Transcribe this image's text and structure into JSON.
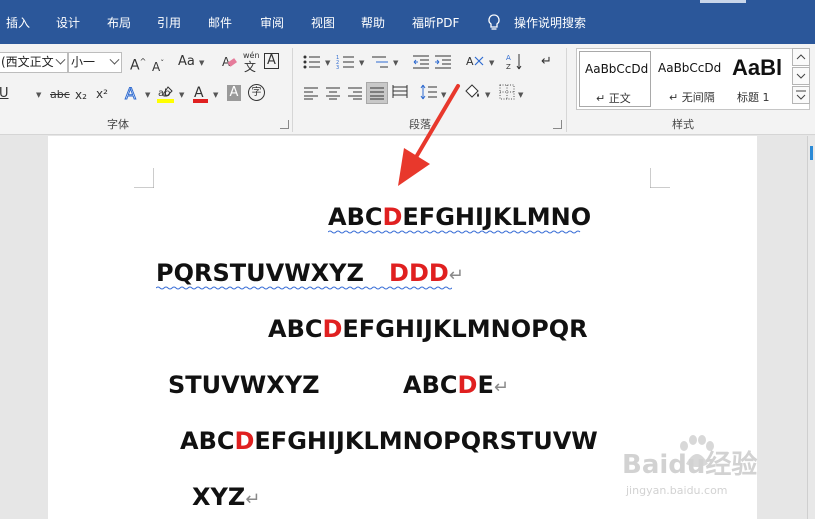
{
  "tabs": [
    "插入",
    "设计",
    "布局",
    "引用",
    "邮件",
    "审阅",
    "视图",
    "帮助",
    "福昕PDF"
  ],
  "tell_me": "操作说明搜索",
  "font_group": {
    "font_name": "(西文正文",
    "font_size": "小一",
    "label": "字体",
    "change_case": "Aa",
    "phonetic_top": "wén",
    "phonetic_bottom": "文",
    "char_border": "A",
    "enclose_char": "字",
    "underline": "U",
    "strike": "abc",
    "subscript": "x₂",
    "superscript": "x²"
  },
  "paragraph_group": {
    "label": "段落"
  },
  "styles_group": {
    "label": "样式",
    "items": [
      {
        "sample": "AaBbCcDd",
        "name": "↵ 正文"
      },
      {
        "sample": "AaBbCcDd",
        "name": "↵ 无间隔"
      },
      {
        "sample": "AaBl",
        "name": "标题 1"
      }
    ]
  },
  "document": {
    "lines": [
      {
        "parts": [
          "ABC",
          "D",
          "EFGHIJKLMNO"
        ],
        "mark": ""
      },
      {
        "parts": [
          "PQRSTUVWXYZ   ",
          "DDD",
          ""
        ],
        "mark": "↵"
      },
      {
        "parts": [
          "ABC",
          "D",
          "EFGHIJKLMNOPQR"
        ],
        "mark": ""
      },
      {
        "parts": [
          "STUVWXYZ          ABC",
          "D",
          "E"
        ],
        "mark": "↵"
      },
      {
        "parts": [
          "ABC",
          "D",
          "EFGHIJKLMNOPQRSTUVW"
        ],
        "mark": ""
      },
      {
        "parts": [
          "XYZ",
          "",
          ""
        ],
        "mark": "↵"
      }
    ]
  },
  "watermark": {
    "brand": "Baidu经验",
    "url": "jingyan.baidu.com"
  },
  "colors": {
    "ribbon_blue": "#2b579a",
    "highlight_red": "#e02020",
    "annotation_arrow": "#e8382c"
  }
}
